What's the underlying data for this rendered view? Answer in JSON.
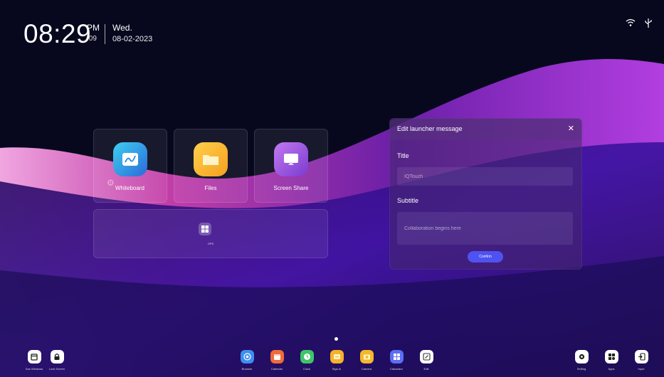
{
  "clock": {
    "time": "08:29",
    "ampm": "PM",
    "seconds": ":09",
    "day": "Wed.",
    "date": "08-02-2023"
  },
  "status": {
    "wifi_icon": "wifi-icon",
    "usb_icon": "usb-icon"
  },
  "tiles": {
    "whiteboard": "Whiteboard",
    "files": "Files",
    "screen_share": "Screen Share",
    "ops": "OPS"
  },
  "dialog": {
    "title": "Edit launcher message",
    "title_label": "Title",
    "title_placeholder": "IQTouch",
    "subtitle_label": "Subtitle",
    "subtitle_placeholder": "Collaboration begins here",
    "confirm": "Confirm"
  },
  "dock": {
    "left": [
      {
        "label": "Dos Windows",
        "icon": "window-icon"
      },
      {
        "label": "Lock Screen",
        "icon": "lock-icon"
      }
    ],
    "center": [
      {
        "label": "Browser",
        "icon": "browser-icon",
        "color": "#3d8ef0"
      },
      {
        "label": "Calendar",
        "icon": "calendar-icon",
        "color": "#f06a3a"
      },
      {
        "label": "Clock",
        "icon": "clock-icon",
        "color": "#3fc46a"
      },
      {
        "label": "Sign-in",
        "icon": "sign-in-icon",
        "color": "#f5b22a"
      },
      {
        "label": "Camera",
        "icon": "camera-icon",
        "color": "#f5b82a"
      },
      {
        "label": "Calculator",
        "icon": "calculator-icon",
        "color": "#5b6ef5"
      },
      {
        "label": "Edit",
        "icon": "edit-icon",
        "color": "#ffffff"
      }
    ],
    "right": [
      {
        "label": "Setting",
        "icon": "gear-icon"
      },
      {
        "label": "Apps",
        "icon": "apps-icon"
      },
      {
        "label": "Input",
        "icon": "input-icon"
      }
    ]
  },
  "colors": {
    "accent": "#4f52f0",
    "background": "#0a0a24",
    "wave": "#9b2fd6"
  }
}
